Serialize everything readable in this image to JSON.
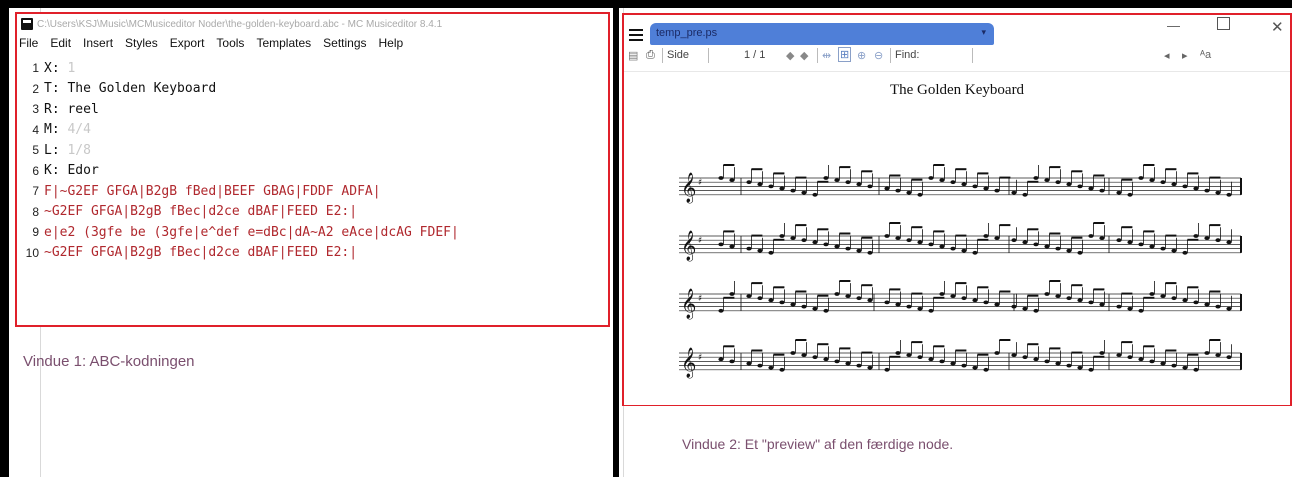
{
  "editor": {
    "title": "C:\\Users\\KSJ\\Music\\MCMusiceditor Noder\\the-golden-keyboard.abc - MC Musiceditor 8.4.1",
    "menu": [
      "File",
      "Edit",
      "Insert",
      "Styles",
      "Export",
      "Tools",
      "Templates",
      "Settings",
      "Help"
    ],
    "lines": [
      {
        "num": "1",
        "key": "X:",
        "val": "1",
        "valStyle": "faint"
      },
      {
        "num": "2",
        "key": "T:",
        "val": "The Golden Keyboard",
        "valStyle": "black"
      },
      {
        "num": "3",
        "key": "R:",
        "val": "reel",
        "valStyle": "black"
      },
      {
        "num": "4",
        "key": "M:",
        "val": "4/4",
        "valStyle": "faint"
      },
      {
        "num": "5",
        "key": "L:",
        "val": "1/8",
        "valStyle": "faint"
      },
      {
        "num": "6",
        "key": "K:",
        "val": "Edor",
        "valStyle": "black"
      },
      {
        "num": "7",
        "key": "",
        "val": "F|~G2EF GFGA|B2gB fBed|BEEF GBAG|FDDF ADFA|",
        "valStyle": "red"
      },
      {
        "num": "8",
        "key": "",
        "val": "~G2EF GFGA|B2gB fBec|d2ce dBAF|FEED E2:|",
        "valStyle": "red"
      },
      {
        "num": "9",
        "key": "",
        "val": "e|e2 (3gfe be (3gfe|e^def e=dBc|dA~A2 eAce|dcAG FDEF|",
        "valStyle": "red"
      },
      {
        "num": "10",
        "key": "",
        "val": "~G2EF GFGA|B2gB fBec|d2ce dBAF|FEED E2:|",
        "valStyle": "red"
      }
    ]
  },
  "left_caption": "Vindue 1: ABC-kodningen",
  "preview": {
    "tab_label": "temp_pre.ps",
    "toolbar": {
      "side_label": "Side",
      "page_indicator": "1 / 1",
      "find_label": "Find:"
    },
    "tune_title": "The Golden Keyboard"
  },
  "right_caption": "Vindue 2: Et \"preview\" af den færdige node."
}
